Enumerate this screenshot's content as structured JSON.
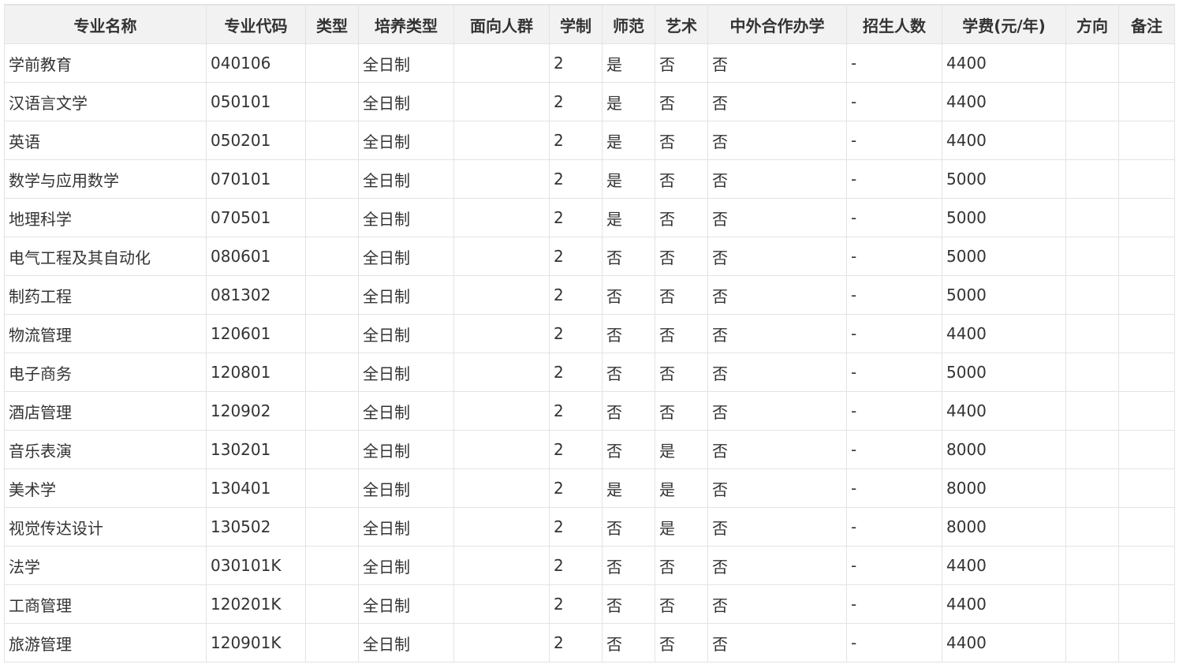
{
  "table": {
    "headers": [
      "专业名称",
      "专业代码",
      "类型",
      "培养类型",
      "面向人群",
      "学制",
      "师范",
      "艺术",
      "中外合作办学",
      "招生人数",
      "学费(元/年)",
      "方向",
      "备注"
    ],
    "rows": [
      [
        "学前教育",
        "040106",
        "",
        "全日制",
        "",
        "2",
        "是",
        "否",
        "否",
        "-",
        "4400",
        "",
        ""
      ],
      [
        "汉语言文学",
        "050101",
        "",
        "全日制",
        "",
        "2",
        "是",
        "否",
        "否",
        "-",
        "4400",
        "",
        ""
      ],
      [
        "英语",
        "050201",
        "",
        "全日制",
        "",
        "2",
        "是",
        "否",
        "否",
        "-",
        "4400",
        "",
        ""
      ],
      [
        "数学与应用数学",
        "070101",
        "",
        "全日制",
        "",
        "2",
        "是",
        "否",
        "否",
        "-",
        "5000",
        "",
        ""
      ],
      [
        "地理科学",
        "070501",
        "",
        "全日制",
        "",
        "2",
        "是",
        "否",
        "否",
        "-",
        "5000",
        "",
        ""
      ],
      [
        "电气工程及其自动化",
        "080601",
        "",
        "全日制",
        "",
        "2",
        "否",
        "否",
        "否",
        "-",
        "5000",
        "",
        ""
      ],
      [
        "制药工程",
        "081302",
        "",
        "全日制",
        "",
        "2",
        "否",
        "否",
        "否",
        "-",
        "5000",
        "",
        ""
      ],
      [
        "物流管理",
        "120601",
        "",
        "全日制",
        "",
        "2",
        "否",
        "否",
        "否",
        "-",
        "4400",
        "",
        ""
      ],
      [
        "电子商务",
        "120801",
        "",
        "全日制",
        "",
        "2",
        "否",
        "否",
        "否",
        "-",
        "5000",
        "",
        ""
      ],
      [
        "酒店管理",
        "120902",
        "",
        "全日制",
        "",
        "2",
        "否",
        "否",
        "否",
        "-",
        "4400",
        "",
        ""
      ],
      [
        "音乐表演",
        "130201",
        "",
        "全日制",
        "",
        "2",
        "否",
        "是",
        "否",
        "-",
        "8000",
        "",
        ""
      ],
      [
        "美术学",
        "130401",
        "",
        "全日制",
        "",
        "2",
        "是",
        "是",
        "否",
        "-",
        "8000",
        "",
        ""
      ],
      [
        "视觉传达设计",
        "130502",
        "",
        "全日制",
        "",
        "2",
        "否",
        "是",
        "否",
        "-",
        "8000",
        "",
        ""
      ],
      [
        "法学",
        "030101K",
        "",
        "全日制",
        "",
        "2",
        "否",
        "否",
        "否",
        "-",
        "4400",
        "",
        ""
      ],
      [
        "工商管理",
        "120201K",
        "",
        "全日制",
        "",
        "2",
        "否",
        "否",
        "否",
        "-",
        "4400",
        "",
        ""
      ],
      [
        "旅游管理",
        "120901K",
        "",
        "全日制",
        "",
        "2",
        "否",
        "否",
        "否",
        "-",
        "4400",
        "",
        ""
      ]
    ]
  }
}
